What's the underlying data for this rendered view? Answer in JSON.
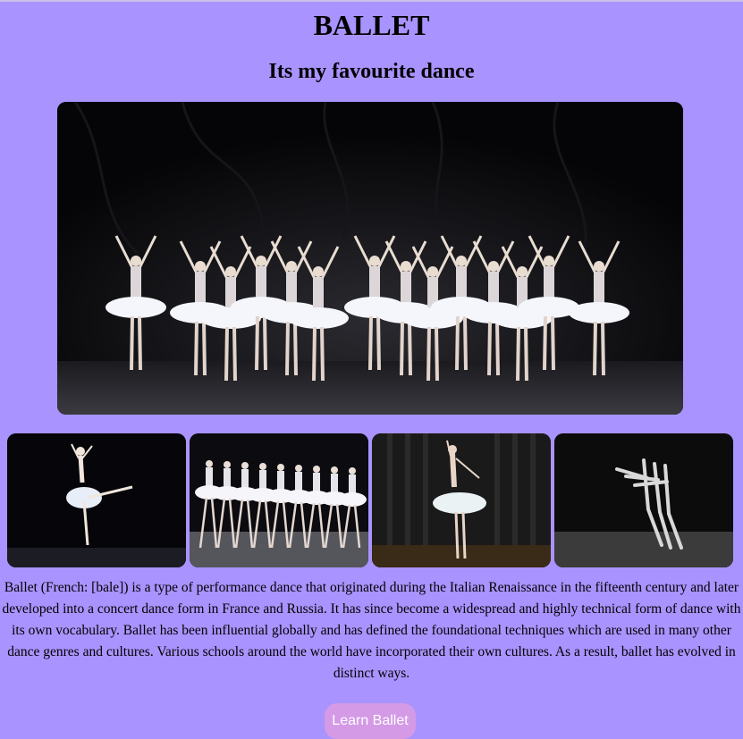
{
  "page": {
    "title": "BALLET",
    "subtitle": "Its my favourite dance"
  },
  "images": {
    "hero": "ballet-corps-stage-photo",
    "thumbnails": [
      "ballerina-arabesque-photo",
      "swan-lake-line-photo",
      "ballerina-pointe-curtain-photo",
      "monochrome-dancers-photo"
    ]
  },
  "description": "Ballet (French: [bale]) is a type of performance dance that originated during the Italian Renaissance in the fifteenth century and later developed into a concert dance form in France and Russia. It has since become a widespread and highly technical form of dance with its own vocabulary. Ballet has been influential globally and has defined the foundational techniques which are used in many other dance genres and cultures. Various schools around the world have incorporated their own cultures. As a result, ballet has evolved in distinct ways.",
  "cta": {
    "label": "Learn Ballet"
  },
  "colors": {
    "background": "#a993fe",
    "button": "#d49ae6",
    "button_text": "#ffffff"
  }
}
